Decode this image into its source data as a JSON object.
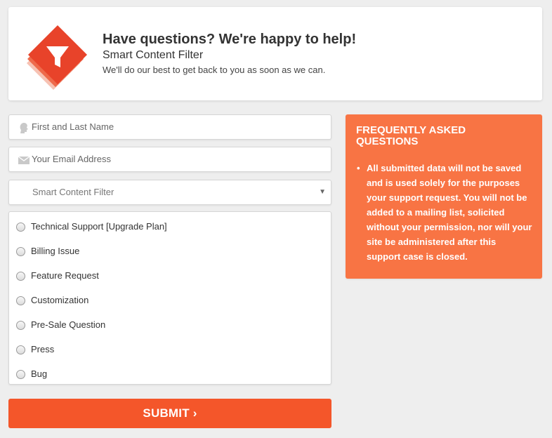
{
  "header": {
    "title": "Have questions? We're happy to help!",
    "subtitle": "Smart Content Filter",
    "note": "We'll do our best to get back to you as soon as we can.",
    "logo_icon": "funnel-filter-icon",
    "logo_color": "#e8432a"
  },
  "form": {
    "name_placeholder": "First and Last Name",
    "email_placeholder": "Your Email Address",
    "product_select": {
      "selected": "Smart Content Filter",
      "arrow": "▼"
    },
    "request_types": [
      "Technical Support [Upgrade Plan]",
      "Billing Issue",
      "Feature Request",
      "Customization",
      "Pre-Sale Question",
      "Press",
      "Bug"
    ],
    "submit_label": "SUBMIT ›",
    "submit_color": "#f4562a"
  },
  "faq": {
    "title": "FREQUENTLY ASKED QUESTIONS",
    "bullet": "•",
    "items": [
      "All submitted data will not be saved and is used solely for the purposes your support request. You will not be added to a mailing list, solicited without your permission, nor will your site be administered after this support case is closed."
    ],
    "color": "#f87444"
  }
}
